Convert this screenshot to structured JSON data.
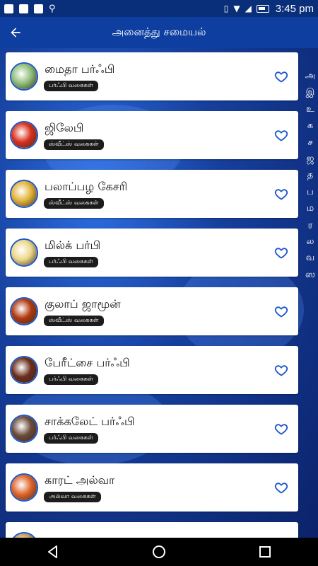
{
  "status": {
    "time": "3:45 pm"
  },
  "app_bar": {
    "title": "அனைத்து சமையல்",
    "back_icon": "arrow-back-icon"
  },
  "recipes": [
    {
      "title": "மைதா பர்ஃபி",
      "category": "பர்ஃபி வகைகள்",
      "thumb_color": "#8fbf7a"
    },
    {
      "title": "ஜிலேபி",
      "category": "ஸ்வீட்ஸ் வகைகள்",
      "thumb_color": "#d9301e"
    },
    {
      "title": "பலாப்பழ கேசரி",
      "category": "ஸ்வீட்ஸ் வகைகள்",
      "thumb_color": "#e3b33a"
    },
    {
      "title": "மில்க் பர்பி",
      "category": "பர்ஃபி வகைகள்",
      "thumb_color": "#ecd88a"
    },
    {
      "title": "குலாப் ஜாமூன்",
      "category": "ஸ்வீட்ஸ் வகைகள்",
      "thumb_color": "#b0390e"
    },
    {
      "title": "பேரீட்சை பர்ஃபி",
      "category": "பர்ஃபி வகைகள்",
      "thumb_color": "#6b2d1a"
    },
    {
      "title": "சாக்கலேட் பர்ஃபி",
      "category": "பர்ஃபி வகைகள்",
      "thumb_color": "#6a4a3a"
    },
    {
      "title": "காரட் அல்வா",
      "category": "அல்வா வகைகள்",
      "thumb_color": "#e0642a"
    },
    {
      "title": "",
      "category": "",
      "thumb_color": "#c9a060"
    }
  ],
  "index_letters": [
    "அ",
    "இ",
    "உ",
    "க",
    "ச",
    "ஜ",
    "த",
    "ப",
    "ம",
    "ர",
    "ல",
    "வ",
    "ஸ"
  ],
  "colors": {
    "app_bar": "#0d3ea0",
    "heart": "#1e58c8"
  }
}
